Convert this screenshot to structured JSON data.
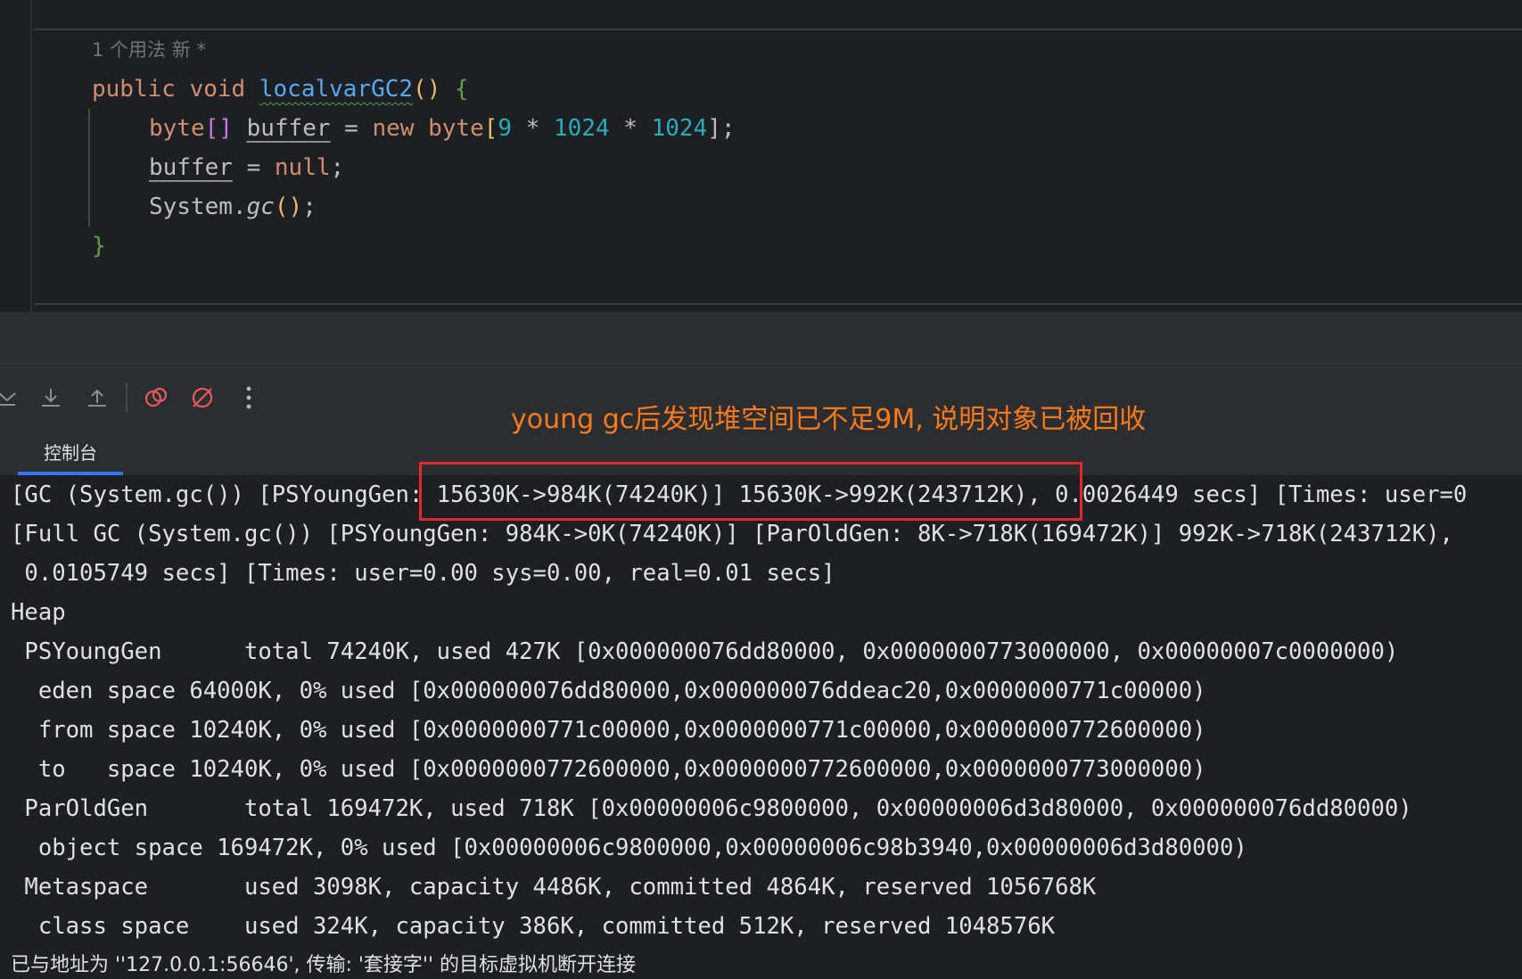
{
  "editor": {
    "usage_hint": "1 个用法   新 *",
    "line1": {
      "kw1": "public",
      "kw2": "void",
      "method": "localvarGC2",
      "parens": "()",
      "brace": "{"
    },
    "line2": {
      "type": "byte",
      "brackets": "[]",
      "var": "buffer",
      "eq": "=",
      "new": "new",
      "type2": "byte",
      "open": "[",
      "n1": "9",
      "op1": "*",
      "n2": "1024",
      "op2": "*",
      "n3": "1024",
      "close": "];"
    },
    "line3": {
      "var": "buffer",
      "eq": "=",
      "null": "null",
      "semi": ";"
    },
    "line4": {
      "obj": "System.",
      "method": "gc",
      "parens": "()",
      "semi": ";"
    },
    "line5": {
      "brace": "}"
    }
  },
  "toolbar": {
    "icons": [
      "scroll-to-end-icon",
      "download-icon",
      "upload-icon",
      "rerun-icon",
      "clear-icon",
      "more-icon"
    ]
  },
  "tabs": {
    "console": "控制台"
  },
  "annotation": "young gc后发现堆空间已不足9M, 说明对象已被回收",
  "console": {
    "lines": [
      "[GC (System.gc()) [PSYoungGen: 15630K->984K(74240K)] 15630K->992K(243712K), 0.0026449 secs] [Times: user=0",
      "[Full GC (System.gc()) [PSYoungGen: 984K->0K(74240K)] [ParOldGen: 8K->718K(169472K)] 992K->718K(243712K),",
      " 0.0105749 secs] [Times: user=0.00 sys=0.00, real=0.01 secs]",
      "Heap",
      " PSYoungGen      total 74240K, used 427K [0x000000076dd80000, 0x0000000773000000, 0x00000007c0000000)",
      "  eden space 64000K, 0% used [0x000000076dd80000,0x000000076ddeac20,0x0000000771c00000)",
      "  from space 10240K, 0% used [0x0000000771c00000,0x0000000771c00000,0x0000000772600000)",
      "  to   space 10240K, 0% used [0x0000000772600000,0x0000000772600000,0x0000000773000000)",
      " ParOldGen       total 169472K, used 718K [0x00000006c9800000, 0x00000006d3d80000, 0x000000076dd80000)",
      "  object space 169472K, 0% used [0x00000006c9800000,0x00000006c98b3940,0x00000006d3d80000)",
      " Metaspace       used 3098K, capacity 4486K, committed 4864K, reserved 1056768K",
      "  class space    used 324K, capacity 386K, committed 512K, reserved 1048576K",
      "已与地址为 ''127.0.0.1:56646', 传输: '套接字'' 的目标虚拟机断开连接"
    ]
  },
  "colors": {
    "annotation": "#ff7a1a",
    "highlight_box": "#e0282e",
    "tab_underline": "#3574f0"
  }
}
